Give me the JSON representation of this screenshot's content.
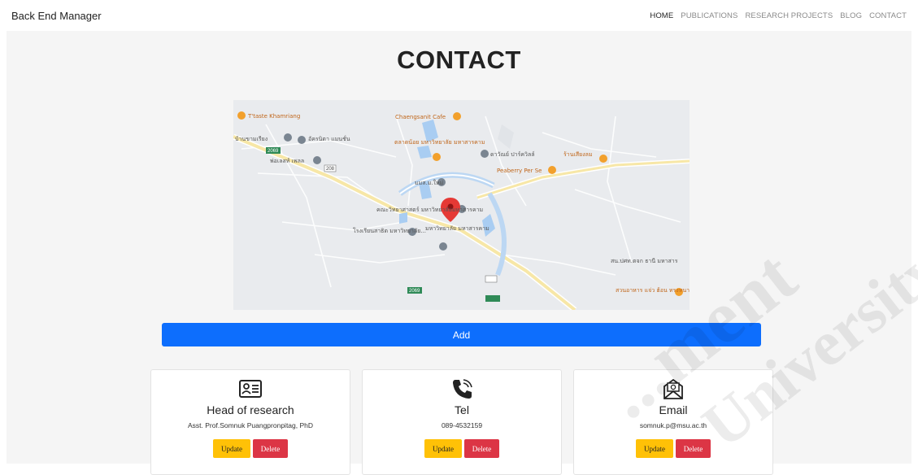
{
  "navbar": {
    "brand": "Back End Manager",
    "links": [
      "HOME",
      "PUBLICATIONS",
      "RESEARCH PROJECTS",
      "BLOG",
      "CONTACT"
    ]
  },
  "page": {
    "title": "CONTACT"
  },
  "map": {
    "labels": [
      "T'taste Khamriang",
      "Chaengsanit Cafe",
      "บ้านขามเรียง",
      "อัครนิตา แมนชั่น",
      "ตลาดน้อย มหาวิทยาลัย มหาสารคาม",
      "ดาวัณย์ ปาร์ควิลล์",
      "ร้านเสียงลม",
      "พ่อเลสท์ เพลล",
      "Peaberry Per Se",
      "มมส.ม.ใหม่",
      "คณะวิทยาศาสตร์ มหาวิทยาลัยมหาสารคาม",
      "โรงเรียนสาธิต มหาวิทยาลัย...",
      "มหาวิทยาลัย มหาสารคาม",
      "สน.ปศท.ตจก ธานี มหาสาร",
      "สวนอาหาร แจ่ว ฮ้อน ทรงหนาว"
    ],
    "road_shields": [
      "2069",
      "208",
      "2069"
    ]
  },
  "actions": {
    "add_label": "Add"
  },
  "cards": [
    {
      "title": "Head of research",
      "value": "Asst. Prof.Somnuk Puangpronpitag, PhD",
      "icon": "id-card-icon"
    },
    {
      "title": "Tel",
      "value": "089-4532159",
      "icon": "phone-icon"
    },
    {
      "title": "Email",
      "value": "somnuk.p@msu.ac.th",
      "icon": "email-icon"
    }
  ],
  "card_buttons": {
    "update": "Update",
    "delete": "Delete"
  },
  "watermark": {
    "line1": "...ment",
    "line2": "University"
  }
}
